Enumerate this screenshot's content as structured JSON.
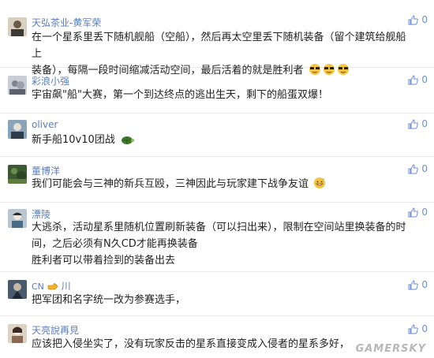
{
  "like_icon": "thumbs-up-icon",
  "colors": {
    "username": "#5a7dbf",
    "like": "#6d8fd0",
    "divider": "#e9e9e9"
  },
  "comments": [
    {
      "user": "天弘茶业-黄军荣",
      "likes": "0",
      "lines": [
        "在一个星系里丢下随机舰船（空船），然后再太空里丢下随机装备（留个建筑给舰船上",
        "装备），每隔一段时间缩减活动空间，最后活着的就是胜利者"
      ],
      "emoji": "sunglasses-emoji x3"
    },
    {
      "user": "彩浪小强",
      "likes": "0",
      "lines": [
        "宇宙飙\"船\"大赛，第一个到达终点的逃出生天，剩下的船蛋双爆！"
      ]
    },
    {
      "user": "oliver",
      "likes": "0",
      "lines": [
        "新手船10v10团战"
      ],
      "emoji": "turtle-emoji"
    },
    {
      "user": "董博洋",
      "likes": "0",
      "lines": [
        "我们可能会与三神的新兵互殴，三神因此与玩家建下战争友谊"
      ],
      "emoji": "grin-sweat-emoji"
    },
    {
      "user": "漂陵",
      "likes": "0",
      "lines": [
        "大逃杀，活动星系里随机位置刷新装备（可以扫出来），限制在空间站里换装备的时",
        "间，之后必须有N久CD才能再换装备",
        "胜利者可以带着捡到的装备出去"
      ]
    },
    {
      "user_prefix": "CN",
      "user_suffix": "川",
      "likes": "0",
      "lines": [
        "把军团和名字统一改为参赛选手，"
      ],
      "emoji": "pointing-hand-emoji"
    },
    {
      "user": "天亮說再見",
      "likes": "0",
      "lines": [
        "应该把入侵坐实了，没有玩家反击的星系直接变成入侵者的星系多好，"
      ]
    }
  ],
  "watermark": "GAMERSKY"
}
